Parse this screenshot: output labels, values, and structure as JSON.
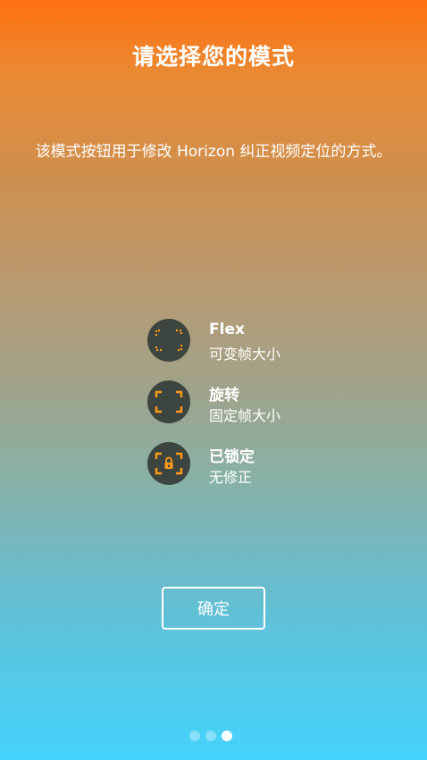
{
  "header": {
    "title": "请选择您的模式",
    "description": "该模式按钮用于修改 Horizon 纠正视频定位的方式。"
  },
  "modes": [
    {
      "name": "Flex",
      "description": "可变帧大小",
      "icon": "dotted-frame-icon"
    },
    {
      "name": "旋转",
      "description": "固定帧大小",
      "icon": "corner-frame-icon"
    },
    {
      "name": "已锁定",
      "description": "无修正",
      "icon": "lock-frame-icon"
    }
  ],
  "confirm_label": "确定",
  "pagination": {
    "total": 3,
    "current": 3
  },
  "colors": {
    "accent": "#ff9a1a",
    "icon_background": "#3d4540",
    "gradient_top": "#ff7010",
    "gradient_bottom": "#44d2fb"
  }
}
